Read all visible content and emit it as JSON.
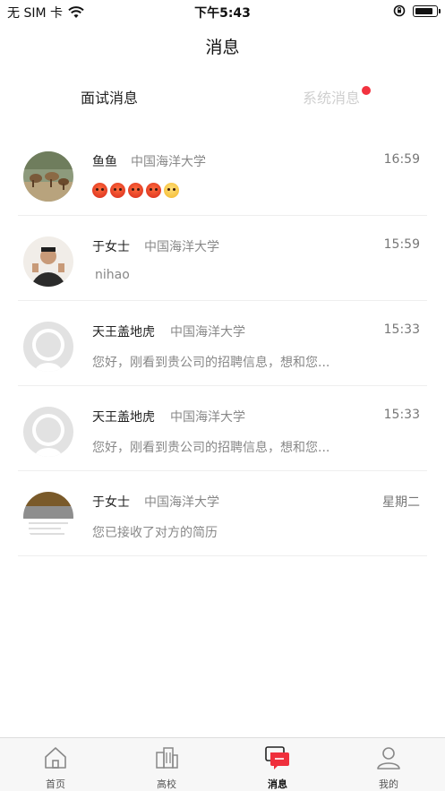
{
  "status": {
    "carrier": "无 SIM 卡",
    "time": "下午5:43"
  },
  "title": "消息",
  "tabs": [
    {
      "label": "面试消息"
    },
    {
      "label": "系统消息"
    }
  ],
  "messages": [
    {
      "name": "鱼鱼",
      "school": "中国海洋大学",
      "time": "16:59",
      "preview": "",
      "emojis": [
        "angry",
        "angry",
        "angry",
        "angry",
        "cry"
      ]
    },
    {
      "name": "于女士",
      "school": "中国海洋大学",
      "time": "15:59",
      "preview": "nihao"
    },
    {
      "name": "天王盖地虎",
      "school": "中国海洋大学",
      "time": "15:33",
      "preview": "您好，刚看到贵公司的招聘信息，想和您..."
    },
    {
      "name": "天王盖地虎",
      "school": "中国海洋大学",
      "time": "15:33",
      "preview": "您好，刚看到贵公司的招聘信息，想和您..."
    },
    {
      "name": "于女士",
      "school": "中国海洋大学",
      "time": "星期二",
      "preview": "您已接收了对方的简历"
    }
  ],
  "tabbar": [
    {
      "label": "首页",
      "icon": "home-icon"
    },
    {
      "label": "高校",
      "icon": "building-icon"
    },
    {
      "label": "消息",
      "icon": "message-icon"
    },
    {
      "label": "我的",
      "icon": "profile-icon"
    }
  ],
  "colors": {
    "accent": "#f2323f",
    "inactive_tab": "#cfcfcf"
  }
}
